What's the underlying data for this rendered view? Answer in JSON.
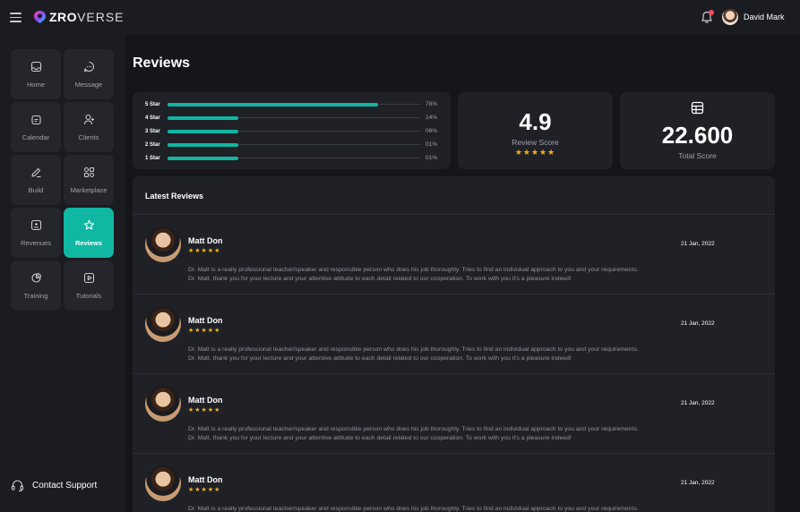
{
  "app": {
    "logo_primary": "ZRO",
    "logo_secondary": "VERSE"
  },
  "header": {
    "user_name": "David Mark",
    "notification_indicator": true
  },
  "sidebar": {
    "items": [
      {
        "label": "Home",
        "icon": "inbox-icon",
        "active": false
      },
      {
        "label": "Message",
        "icon": "chat-icon",
        "active": false
      },
      {
        "label": "Calendar",
        "icon": "calendar-icon",
        "active": false
      },
      {
        "label": "Clients",
        "icon": "user-add-icon",
        "active": false
      },
      {
        "label": "Build",
        "icon": "pencil-icon",
        "active": false
      },
      {
        "label": "Marketplace",
        "icon": "grid-icon",
        "active": false
      },
      {
        "label": "Revenues",
        "icon": "dollar-icon",
        "active": false
      },
      {
        "label": "Reviews",
        "icon": "star-icon",
        "active": true
      },
      {
        "label": "Training",
        "icon": "pie-icon",
        "active": false
      },
      {
        "label": "Tutorials",
        "icon": "play-icon",
        "active": false
      }
    ],
    "support_label": "Contact Support"
  },
  "page": {
    "title": "Reviews"
  },
  "distribution": [
    {
      "label": "5 Star",
      "pct_text": "78%",
      "fraction": 0.83
    },
    {
      "label": "4 Star",
      "pct_text": "14%",
      "fraction": 0.28
    },
    {
      "label": "3 Star",
      "pct_text": "06%",
      "fraction": 0.28
    },
    {
      "label": "2 Star",
      "pct_text": "01%",
      "fraction": 0.28
    },
    {
      "label": "1 Star",
      "pct_text": "01%",
      "fraction": 0.28
    }
  ],
  "score": {
    "value": "4.9",
    "label": "Review Score",
    "stars": "★★★★★"
  },
  "total": {
    "value": "22.600",
    "label": "Total Score",
    "icon": "table-icon"
  },
  "reviews": {
    "heading": "Latest Reviews",
    "items": [
      {
        "name": "Matt Don",
        "stars": "★★★★★",
        "date": "21 Jan, 2022",
        "text_1": "Dr. Matt is a really professional teacher/speaker and responsible person who does his job thoroughly. Tries to find an individual approach to you and your requirements.",
        "text_2": "Dr. Matt, thank you for your lecture and your attentive attitude to each detail related to our cooperation. To work with you it's a pleasure indeed!"
      },
      {
        "name": "Matt Don",
        "stars": "★★★★★",
        "date": "21 Jan, 2022",
        "text_1": "Dr. Matt is a really professional teacher/speaker and responsible person who does his job thoroughly. Tries to find an individual approach to you and your requirements.",
        "text_2": "Dr. Matt, thank you for your lecture and your attentive attitude to each detail related to our cooperation. To work with you it's a pleasure indeed!"
      },
      {
        "name": "Matt Don",
        "stars": "★★★★★",
        "date": "21 Jan, 2022",
        "text_1": "Dr. Matt is a really professional teacher/speaker and responsible person who does his job thoroughly. Tries to find an individual approach to you and your requirements.",
        "text_2": "Dr. Matt, thank you for your lecture and your attentive attitude to each detail related to our cooperation. To work with you it's a pleasure indeed!"
      },
      {
        "name": "Matt Don",
        "stars": "★★★★★",
        "date": "21 Jan, 2022",
        "text_1": "Dr. Matt is a really professional teacher/speaker and responsible person who does his job thoroughly. Tries to find an individual approach to you and your requirements.",
        "text_2": ""
      }
    ]
  },
  "colors": {
    "accent": "#10b7a2",
    "star": "#f5b21a",
    "background": "#15161a",
    "card": "#202127"
  }
}
